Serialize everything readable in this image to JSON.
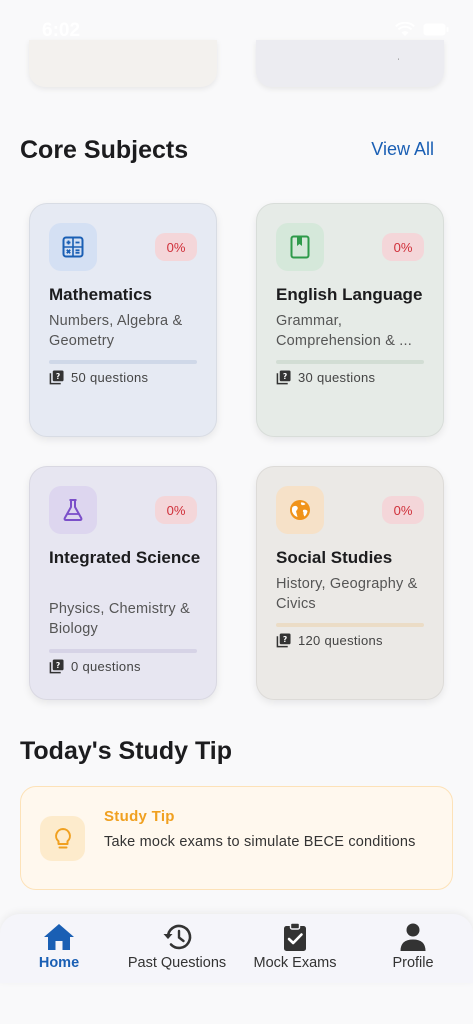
{
  "status_bar": {
    "time": "6:02"
  },
  "sections": {
    "core_subjects": {
      "title": "Core Subjects",
      "view_all": "View All"
    },
    "study_tip": {
      "title": "Today's Study Tip"
    }
  },
  "subjects": [
    {
      "name": "Mathematics",
      "description": "Numbers, Algebra & Geometry",
      "progress_label": "0%",
      "progress": 0,
      "questions": "50 questions",
      "icon": "calculator-icon",
      "accent": "#1a5fb4"
    },
    {
      "name": "English Language",
      "description": "Grammar, Comprehension & ...",
      "progress_label": "0%",
      "progress": 0,
      "questions": "30 questions",
      "icon": "book-icon",
      "accent": "#2e9a4a"
    },
    {
      "name": "Integrated Science",
      "description": "Physics, Chemistry & Biology",
      "progress_label": "0%",
      "progress": 0,
      "questions": "0 questions",
      "icon": "flask-icon",
      "accent": "#7b4fc9"
    },
    {
      "name": "Social Studies",
      "description": "History, Geography & Civics",
      "progress_label": "0%",
      "progress": 0,
      "questions": "120 questions",
      "icon": "globe-icon",
      "accent": "#f0931a"
    }
  ],
  "tip": {
    "label": "Study Tip",
    "text": "Take mock exams to simulate BECE conditions",
    "icon": "lightbulb-icon"
  },
  "nav": [
    {
      "label": "Home",
      "icon": "home-icon",
      "active": true
    },
    {
      "label": "Past Questions",
      "icon": "history-icon",
      "active": false
    },
    {
      "label": "Mock Exams",
      "icon": "clipboard-check-icon",
      "active": false
    },
    {
      "label": "Profile",
      "icon": "person-icon",
      "active": false
    }
  ],
  "colors": {
    "accent": "#1a5fb4",
    "badge_text": "#d0303a",
    "badge_bg": "#f4d6d9",
    "tip_label": "#f0a020"
  }
}
